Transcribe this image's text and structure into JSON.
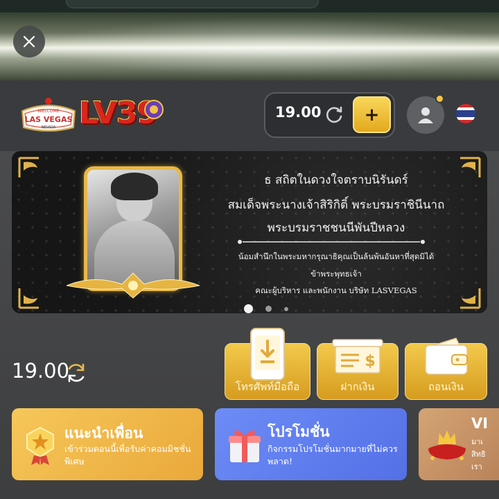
{
  "header": {
    "logo_sign_top": "WELCOME",
    "logo_sign_main": "LAS VEGAS",
    "logo_sign_bottom": "NEVADA",
    "logo_brand": "LV39",
    "balance": "19.00",
    "deposit_plus": "+"
  },
  "banner": {
    "line1": "ธ สถิตในดวงใจตราบนิรันดร์",
    "line2": "สมเด็จพระนางเจ้าสิริกิติ์ พระบรมราชินีนาถ",
    "line3": "พระบรมราชชนนีพันปีหลวง",
    "line4": "น้อมสำนึกในพระมหากรุณาธิคุณเป็นล้นพ้นอันหาที่สุดมิได้",
    "line5": "ข้าพระพุทธเจ้า",
    "line6": "คณะผู้บริหาร และพนักงาน บริษัท LASVEGAS",
    "slide_count": 3,
    "active_slide": 1
  },
  "wallet": {
    "balance": "19.00"
  },
  "actions": [
    {
      "label": "โทรศัพท์มือถือ",
      "icon": "mobile-download-icon"
    },
    {
      "label": "ฝากเงิน",
      "icon": "cash-deposit-icon"
    },
    {
      "label": "ถอนเงิน",
      "icon": "wallet-icon"
    }
  ],
  "promos": [
    {
      "title": "แนะนำเพื่อน",
      "subtitle": "เข้าร่วมตอนนี้เพื่อรับค่าคอมมิชชั่นพิเศษ",
      "icon": "medal-icon",
      "color": "#f2b84a"
    },
    {
      "title": "โปรโมชั่น",
      "subtitle": "กิจกรรมโปรโมชั่นมากมายที่ไม่ควรพลาด!",
      "icon": "gift-icon",
      "color": "#5c7cf0"
    },
    {
      "title": "VI",
      "subtitle": "มาเ สิทธิ เรา",
      "icon": "crown-cushion-icon",
      "color": "#c99767"
    }
  ],
  "colors": {
    "gold": "#e3a91d",
    "brand_red": "#d9261c",
    "page_bg": "#3f4043"
  }
}
